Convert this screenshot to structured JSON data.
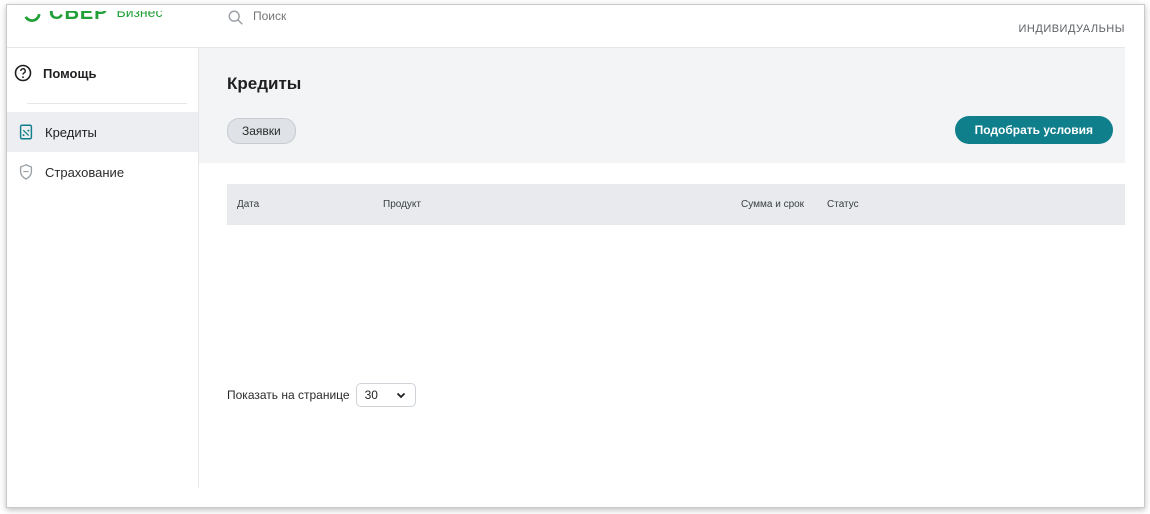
{
  "header": {
    "logo_text": "СБЕР",
    "logo_sub": "Бизнес",
    "search_placeholder": "Поиск",
    "company_name": "ИНДИВИДУАЛЬНЫ"
  },
  "sidebar": {
    "help_label": "Помощь",
    "items": [
      {
        "label": "Кредиты",
        "icon": "credit-document-icon",
        "active": true
      },
      {
        "label": "Страхование",
        "icon": "shield-icon",
        "active": false
      }
    ]
  },
  "main": {
    "title": "Кредиты",
    "chip_label": "Заявки",
    "primary_button": "Подобрать условия",
    "table_headers": [
      "Дата",
      "Продукт",
      "Сумма и срок",
      "Статус"
    ],
    "pager_label": "Показать на странице",
    "pager_value": "30"
  },
  "colors": {
    "brand_green": "#21a038",
    "primary_teal": "#107f8c",
    "header_bg": "#f3f4f6"
  }
}
